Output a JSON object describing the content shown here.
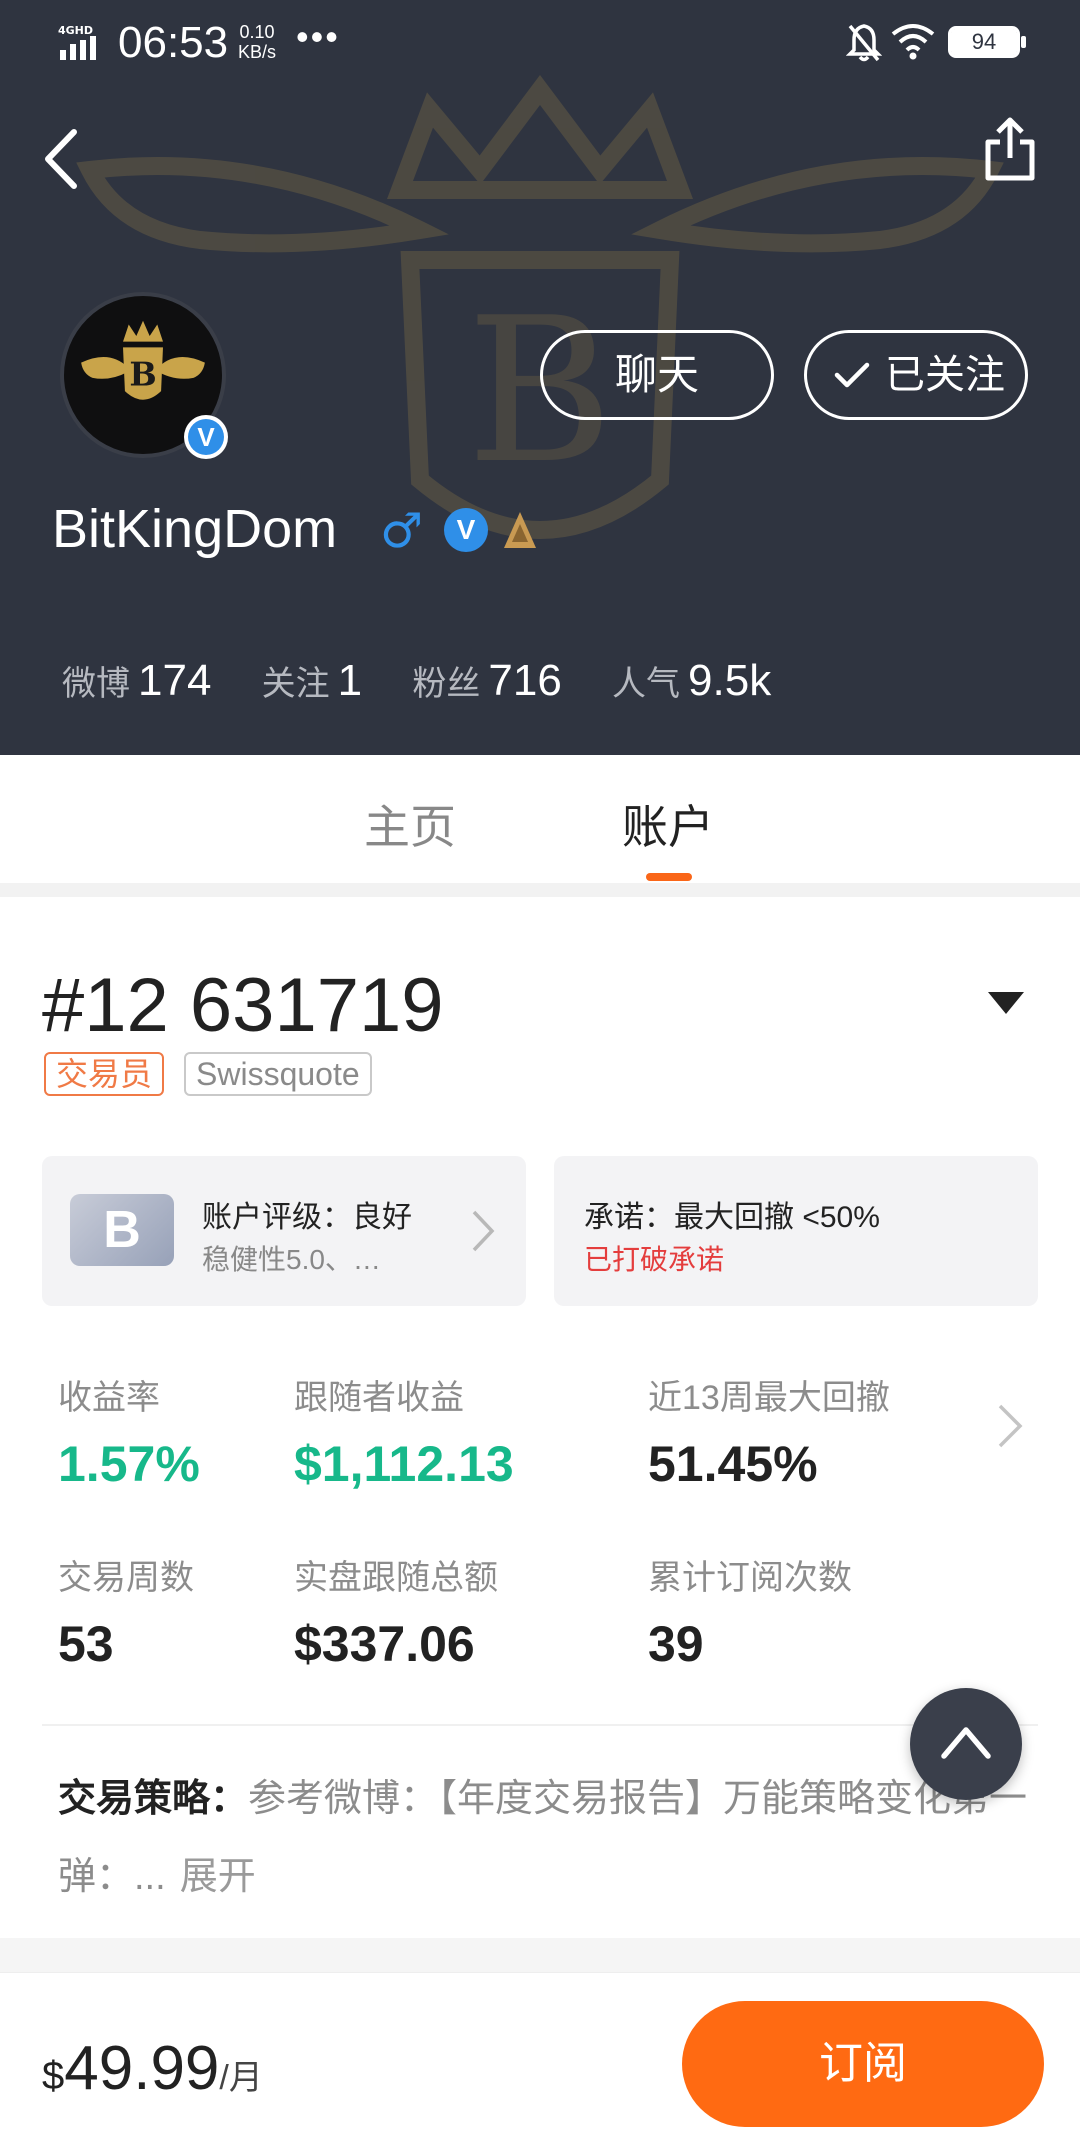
{
  "status_bar": {
    "network": "4GHD",
    "time": "06:53",
    "speed_value": "0.10",
    "speed_unit": "KB/s",
    "more": "•••",
    "battery": "94"
  },
  "profile": {
    "username": "BitKingDom",
    "gender_symbol": "♂",
    "verified_symbol": "V",
    "buttons": {
      "chat": "聊天",
      "follow": "已关注"
    },
    "stats": [
      {
        "label": "微博",
        "value": "174"
      },
      {
        "label": "关注",
        "value": "1"
      },
      {
        "label": "粉丝",
        "value": "716"
      },
      {
        "label": "人气",
        "value": "9.5k"
      }
    ]
  },
  "tabs": [
    {
      "label": "主页",
      "active": false
    },
    {
      "label": "账户",
      "active": true
    }
  ],
  "account": {
    "number": "#12 631719",
    "tags": {
      "role": "交易员",
      "broker": "Swissquote"
    },
    "rating_card": {
      "badge": "B",
      "title": "账户评级：良好",
      "subtitle": "稳健性5.0、…"
    },
    "promise_card": {
      "title": "承诺：最大回撤 <50%",
      "status": "已打破承诺"
    },
    "metrics": [
      {
        "label": "收益率",
        "value": "1.57%",
        "color": "#17b88a"
      },
      {
        "label": "跟随者收益",
        "value": "$1,112.13",
        "color": "#17b88a"
      },
      {
        "label": "近13周最大回撤",
        "value": "51.45%",
        "color": "#222222"
      },
      {
        "label": "交易周数",
        "value": "53",
        "color": "#222222"
      },
      {
        "label": "实盘跟随总额",
        "value": "$337.06",
        "color": "#222222"
      },
      {
        "label": "累计订阅次数",
        "value": "39",
        "color": "#222222"
      }
    ],
    "strategy": {
      "label": "交易策略：",
      "text": "参考微博：【年度交易报告】万能策略变化第一弹：...",
      "more": "展开"
    }
  },
  "bottom_bar": {
    "currency": "$",
    "amount": "49.99",
    "unit": "/月",
    "subscribe_label": "订阅"
  },
  "colors": {
    "accent": "#ff6a12",
    "positive": "#17b88a",
    "warning": "#e43d3d",
    "header_bg": "#2f3440",
    "verified_blue": "#2f8fe8"
  },
  "icons": [
    "back-arrow-icon",
    "share-icon",
    "check-icon",
    "chevron-right-icon",
    "dropdown-arrow-icon",
    "scroll-top-icon",
    "bell-muted-icon",
    "wifi-icon",
    "signal-icon",
    "level-icon"
  ]
}
